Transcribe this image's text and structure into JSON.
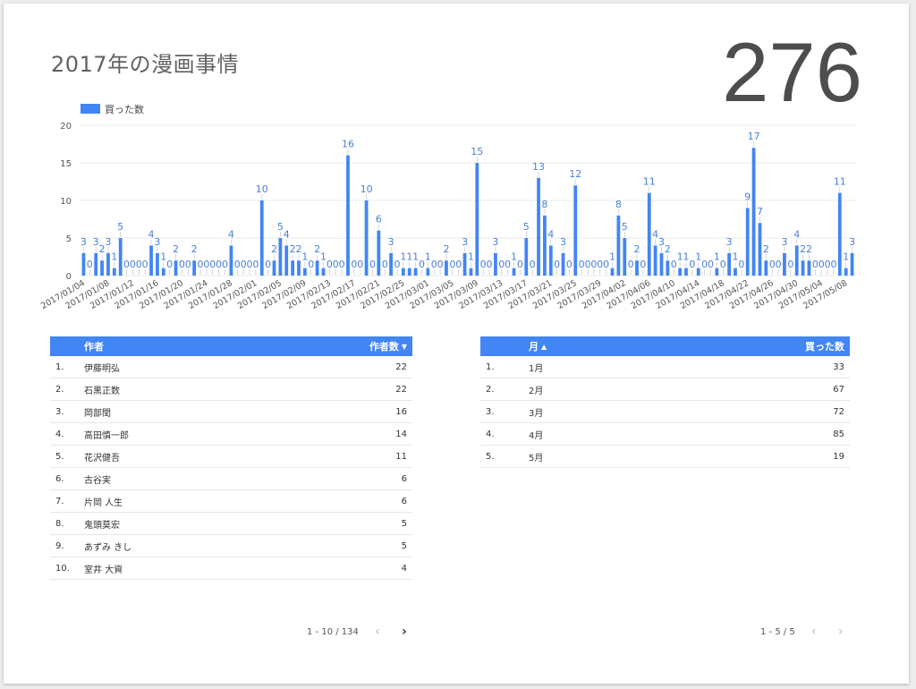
{
  "report": {
    "title": "2017年の漫画事情",
    "scorecard": "276"
  },
  "chart_data": {
    "type": "bar",
    "legend": "買った数",
    "legend_position": "top-left",
    "color": "#4285f4",
    "ylim": [
      0,
      20
    ],
    "yticks": [
      "0",
      "5",
      "10",
      "15",
      "20"
    ],
    "xtick_labels": [
      "2017/01/04",
      "2017/01/08",
      "2017/01/12",
      "2017/01/16",
      "2017/01/20",
      "2017/01/24",
      "2017/01/28",
      "2017/02/01",
      "2017/02/05",
      "2017/02/09",
      "2017/02/13",
      "2017/02/17",
      "2017/02/21",
      "2017/02/25",
      "2017/03/01",
      "2017/03/05",
      "2017/03/09",
      "2017/03/13",
      "2017/03/17",
      "2017/03/21",
      "2017/03/25",
      "2017/03/29",
      "2017/04/02",
      "2017/04/06",
      "2017/04/10",
      "2017/04/14",
      "2017/04/18",
      "2017/04/22",
      "2017/04/26",
      "2017/04/30",
      "2017/05/04",
      "2017/05/08"
    ],
    "values": [
      3,
      0,
      3,
      2,
      3,
      1,
      5,
      0,
      0,
      0,
      0,
      4,
      3,
      1,
      0,
      2,
      0,
      0,
      2,
      0,
      0,
      0,
      0,
      0,
      4,
      0,
      0,
      0,
      0,
      10,
      0,
      2,
      5,
      4,
      2,
      2,
      1,
      0,
      2,
      1,
      0,
      0,
      0,
      16,
      0,
      0,
      10,
      0,
      6,
      0,
      3,
      0,
      1,
      1,
      1,
      0,
      1,
      0,
      0,
      2,
      0,
      0,
      3,
      1,
      15,
      0,
      0,
      3,
      0,
      0,
      1,
      0,
      5,
      0,
      13,
      8,
      4,
      0,
      3,
      0,
      12,
      0,
      0,
      0,
      0,
      0,
      1,
      8,
      5,
      0,
      2,
      0,
      11,
      4,
      3,
      2,
      0,
      1,
      1,
      0,
      1,
      0,
      0,
      1,
      0,
      3,
      1,
      0,
      9,
      17,
      7,
      2,
      0,
      0,
      3,
      0,
      4,
      2,
      2,
      0,
      0,
      0,
      0,
      11,
      1,
      3
    ]
  },
  "authors_table": {
    "headers": {
      "name": "作者",
      "value": "作者数",
      "sort_icon": "▼"
    },
    "rows": [
      {
        "idx": "1.",
        "name": "伊藤明弘",
        "value": "22"
      },
      {
        "idx": "2.",
        "name": "石黒正数",
        "value": "22"
      },
      {
        "idx": "3.",
        "name": "岡部閏",
        "value": "16"
      },
      {
        "idx": "4.",
        "name": "高田慎一郎",
        "value": "14"
      },
      {
        "idx": "5.",
        "name": "花沢健吾",
        "value": "11"
      },
      {
        "idx": "6.",
        "name": "古谷実",
        "value": "6"
      },
      {
        "idx": "7.",
        "name": "片岡 人生",
        "value": "6"
      },
      {
        "idx": "8.",
        "name": "鬼頭莫宏",
        "value": "5"
      },
      {
        "idx": "9.",
        "name": "あずみ きし",
        "value": "5"
      },
      {
        "idx": "10.",
        "name": "室井 大資",
        "value": "4"
      }
    ],
    "pagination": "1 - 10 / 134"
  },
  "months_table": {
    "headers": {
      "name": "月",
      "value": "買った数",
      "sort_icon": "▲"
    },
    "rows": [
      {
        "idx": "1.",
        "name": "1月",
        "value": "33"
      },
      {
        "idx": "2.",
        "name": "2月",
        "value": "67"
      },
      {
        "idx": "3.",
        "name": "3月",
        "value": "72"
      },
      {
        "idx": "4.",
        "name": "4月",
        "value": "85"
      },
      {
        "idx": "5.",
        "name": "5月",
        "value": "19"
      }
    ],
    "pagination": "1 - 5 / 5"
  },
  "icons": {
    "prev": "chevron-left-icon",
    "next": "chevron-right-icon"
  }
}
